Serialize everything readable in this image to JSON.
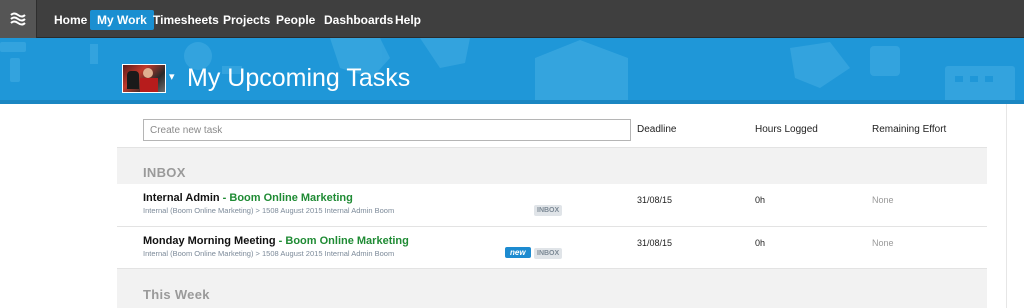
{
  "nav": {
    "logo_icon": "waves-menu-icon",
    "items": [
      "Home",
      "My Work",
      "Timesheets",
      "Projects",
      "People",
      "Dashboards",
      "Help"
    ],
    "active_index": 1
  },
  "banner": {
    "title": "My Upcoming Tasks",
    "avatar_caret": "▾",
    "color": "#1f97d8"
  },
  "task_input": {
    "placeholder": "Create new task",
    "value": ""
  },
  "columns": {
    "deadline": "Deadline",
    "hours": "Hours Logged",
    "effort": "Remaining Effort"
  },
  "sections": [
    {
      "title": "INBOX",
      "tasks": [
        {
          "name": "Internal Admin",
          "separator": " - ",
          "project": "Boom Online Marketing",
          "crumb": "Internal (Boom Online Marketing)  >  1508 August 2015 Internal Admin Boom",
          "badges": [
            "INBOX"
          ],
          "deadline": "31/08/15",
          "hours": "0h",
          "effort": "None"
        },
        {
          "name": "Monday Morning Meeting",
          "separator": " - ",
          "project": "Boom Online Marketing",
          "crumb": "Internal (Boom Online Marketing)  >  1508 August 2015 Internal Admin Boom",
          "badges": [
            "new",
            "INBOX"
          ],
          "deadline": "31/08/15",
          "hours": "0h",
          "effort": "None"
        }
      ]
    },
    {
      "title": "This Week",
      "tasks": []
    }
  ],
  "colors": {
    "nav_bg": "#3f3f3f",
    "nav_active": "#1a8fd1",
    "project_green": "#1f8b34",
    "section_bg": "#f2f2f2"
  }
}
